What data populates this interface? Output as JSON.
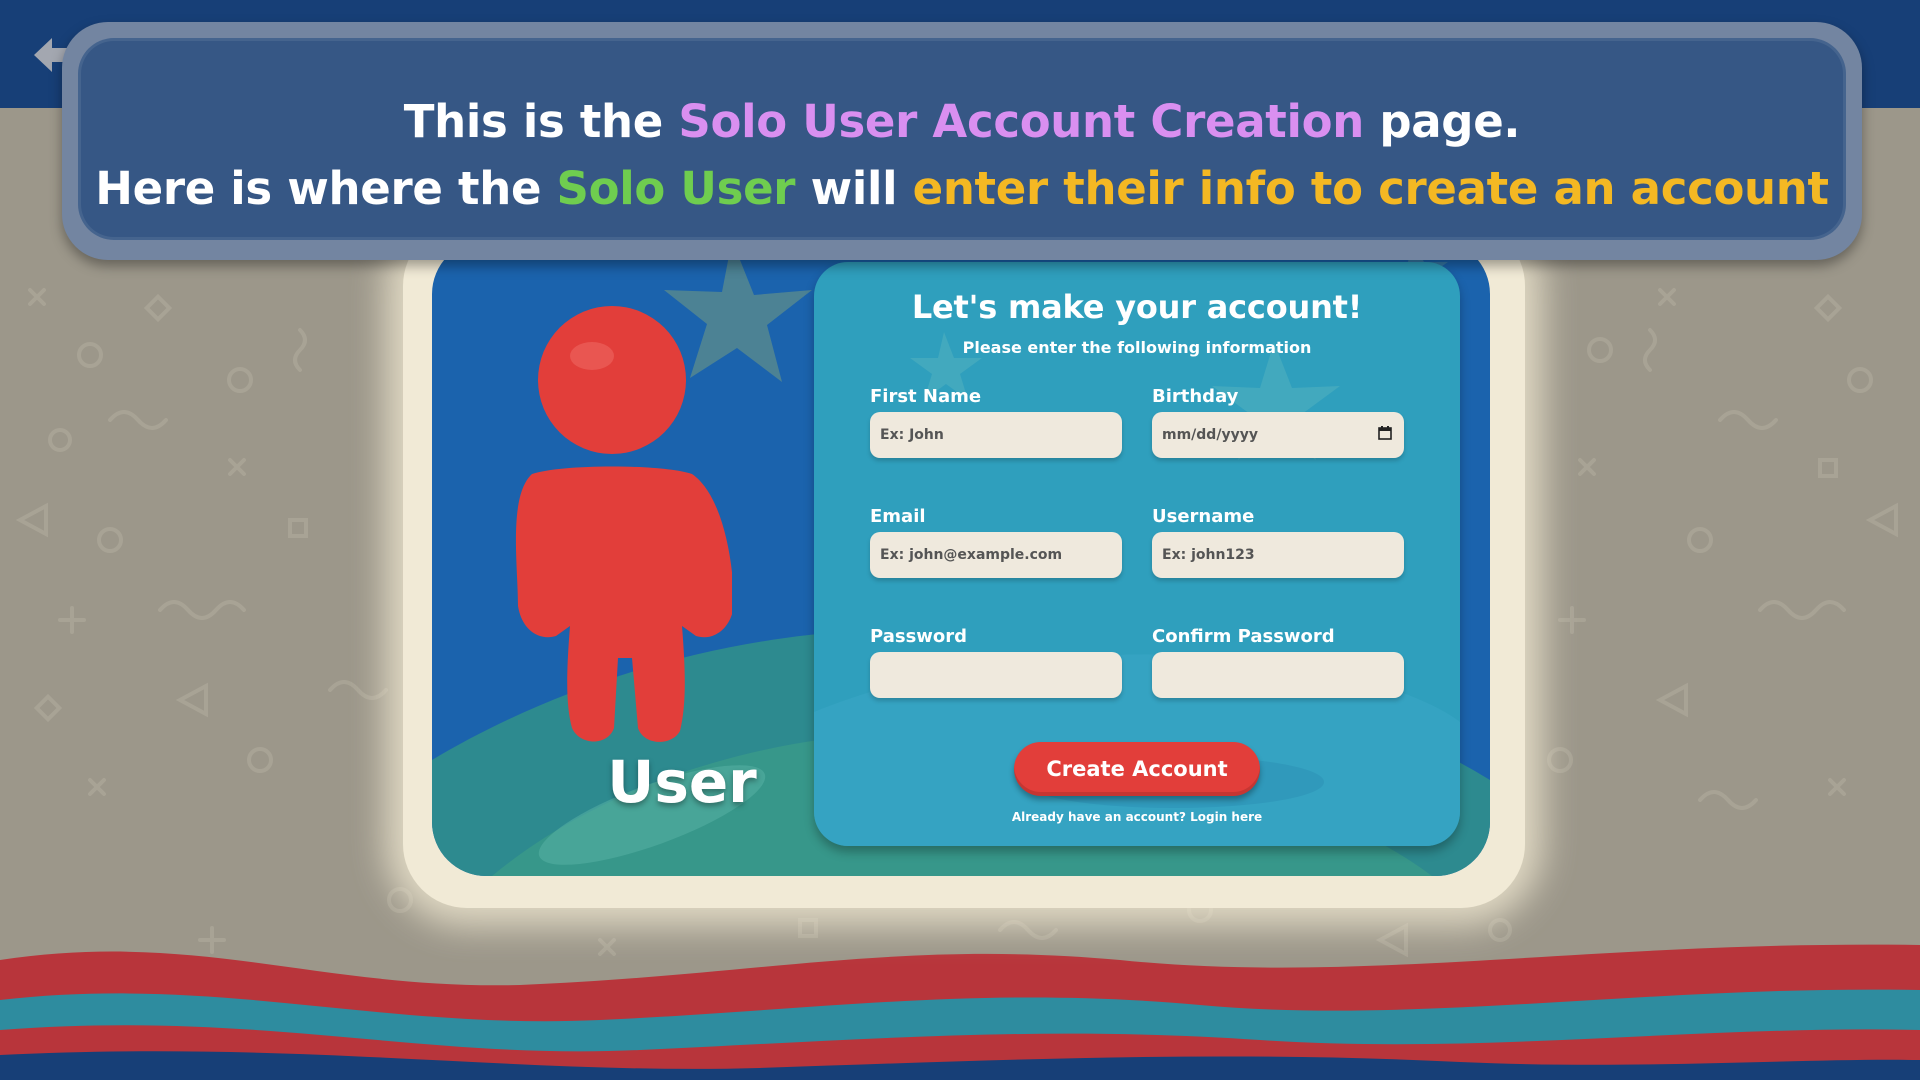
{
  "colors": {
    "top_band": "#173f77",
    "background": "#9c978a",
    "banner": "#365785",
    "highlight_purple": "#d98ff0",
    "highlight_green": "#6fcd4f",
    "highlight_gold": "#f4b823",
    "card_blue": "#1b63ad",
    "form_panel": "#2f9fbd",
    "user_figure": "#e23e3a",
    "button": "#e23e3a"
  },
  "back_button": {
    "icon": "arrow-left-icon"
  },
  "banner": {
    "line1": {
      "pre": "This is the ",
      "highlight": "Solo User Account Creation",
      "post": " page."
    },
    "line2": {
      "pre": "Here is where the ",
      "highlight1": "Solo User",
      "mid": " will ",
      "highlight2": "enter their info to create an account"
    }
  },
  "avatar": {
    "icon": "user-icon",
    "label": "User"
  },
  "form": {
    "title": "Let's make your account!",
    "subtitle": "Please enter the following information",
    "fields": {
      "first_name": {
        "label": "First Name",
        "placeholder": "Ex: John",
        "value": ""
      },
      "birthday": {
        "label": "Birthday",
        "placeholder": "mm/dd/yyyy",
        "value": ""
      },
      "email": {
        "label": "Email",
        "placeholder": "Ex: john@example.com",
        "value": ""
      },
      "username": {
        "label": "Username",
        "placeholder": "Ex: john123",
        "value": ""
      },
      "password": {
        "label": "Password",
        "placeholder": "",
        "value": ""
      },
      "confirm_password": {
        "label": "Confirm Password",
        "placeholder": "",
        "value": ""
      }
    },
    "submit_label": "Create Account",
    "login_prompt": "Already have an account? Login here"
  }
}
